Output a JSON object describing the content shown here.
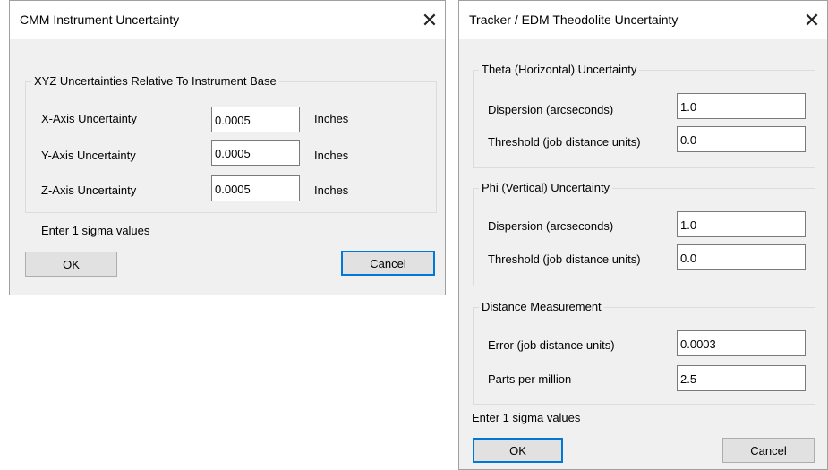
{
  "cmm_dialog": {
    "title": "CMM Instrument Uncertainty",
    "close_symbol": "✕",
    "group_label": "XYZ Uncertainties Relative To Instrument Base",
    "rows": [
      {
        "label": "X-Axis Uncertainty",
        "value": "0.0005",
        "unit": "Inches"
      },
      {
        "label": "Y-Axis Uncertainty",
        "value": "0.0005",
        "unit": "Inches"
      },
      {
        "label": "Z-Axis Uncertainty",
        "value": "0.0005",
        "unit": "Inches"
      }
    ],
    "note": "Enter 1 sigma values",
    "ok_label": "OK",
    "cancel_label": "Cancel"
  },
  "tracker_dialog": {
    "title": "Tracker / EDM Theodolite Uncertainty",
    "close_symbol": "✕",
    "theta_group": {
      "label": "Theta (Horizontal) Uncertainty",
      "dispersion_label": "Dispersion (arcseconds)",
      "dispersion_value": "1.0",
      "threshold_label": "Threshold (job distance units)",
      "threshold_value": "0.0"
    },
    "phi_group": {
      "label": "Phi (Vertical) Uncertainty",
      "dispersion_label": "Dispersion (arcseconds)",
      "dispersion_value": "1.0",
      "threshold_label": "Threshold (job distance units)",
      "threshold_value": "0.0"
    },
    "distance_group": {
      "label": "Distance Measurement",
      "error_label": "Error (job distance units)",
      "error_value": "0.0003",
      "ppm_label": "Parts per million",
      "ppm_value": "2.5"
    },
    "note": "Enter 1 sigma values",
    "ok_label": "OK",
    "cancel_label": "Cancel"
  },
  "colors": {
    "dialog_bg": "#f0f0f0",
    "titlebar_bg": "#ffffff",
    "default_button_border": "#0078d7"
  }
}
